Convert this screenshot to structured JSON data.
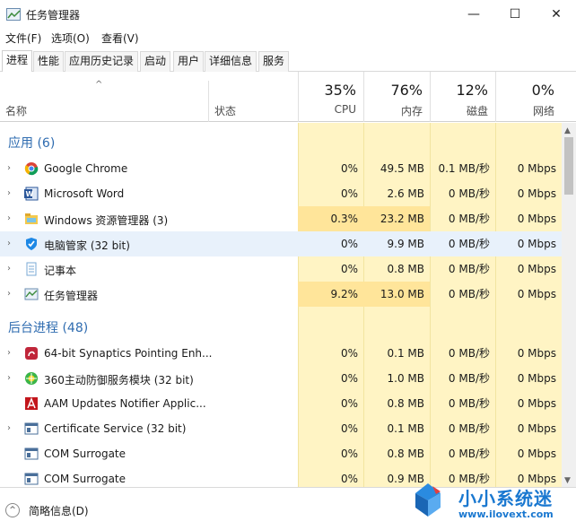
{
  "window": {
    "title": "任务管理器",
    "minimize": "—",
    "maximize": "☐",
    "close": "✕"
  },
  "menu": [
    "文件(F)",
    "选项(O)",
    "查看(V)"
  ],
  "tabs": [
    "进程",
    "性能",
    "应用历史记录",
    "启动",
    "用户",
    "详细信息",
    "服务"
  ],
  "header": {
    "sort_caret": "^",
    "name": "名称",
    "status": "状态",
    "cpu": {
      "pct": "35%",
      "label": "CPU"
    },
    "mem": {
      "pct": "76%",
      "label": "内存"
    },
    "disk": {
      "pct": "12%",
      "label": "磁盘"
    },
    "net": {
      "pct": "0%",
      "label": "网络"
    }
  },
  "groups": {
    "apps": "应用 (6)",
    "background": "后台进程 (48)"
  },
  "rows": [
    {
      "name": "Google Chrome",
      "cpu": "0%",
      "mem": "49.5 MB",
      "disk": "0.1 MB/秒",
      "net": "0 Mbps",
      "icon": "chrome-icon"
    },
    {
      "name": "Microsoft Word",
      "cpu": "0%",
      "mem": "2.6 MB",
      "disk": "0 MB/秒",
      "net": "0 Mbps",
      "icon": "word-icon"
    },
    {
      "name": "Windows 资源管理器 (3)",
      "cpu": "0.3%",
      "mem": "23.2 MB",
      "disk": "0 MB/秒",
      "net": "0 Mbps",
      "icon": "explorer-icon"
    },
    {
      "name": "电脑管家 (32 bit)",
      "cpu": "0%",
      "mem": "9.9 MB",
      "disk": "0 MB/秒",
      "net": "0 Mbps",
      "icon": "shield-icon"
    },
    {
      "name": "记事本",
      "cpu": "0%",
      "mem": "0.8 MB",
      "disk": "0 MB/秒",
      "net": "0 Mbps",
      "icon": "notepad-icon"
    },
    {
      "name": "任务管理器",
      "cpu": "9.2%",
      "mem": "13.0 MB",
      "disk": "0 MB/秒",
      "net": "0 Mbps",
      "icon": "task-manager-icon"
    },
    {
      "name": "64-bit Synaptics Pointing Enh...",
      "cpu": "0%",
      "mem": "0.1 MB",
      "disk": "0 MB/秒",
      "net": "0 Mbps",
      "icon": "synaptics-icon"
    },
    {
      "name": "360主动防御服务模块 (32 bit)",
      "cpu": "0%",
      "mem": "1.0 MB",
      "disk": "0 MB/秒",
      "net": "0 Mbps",
      "icon": "360-icon"
    },
    {
      "name": "AAM Updates Notifier Applic...",
      "cpu": "0%",
      "mem": "0.8 MB",
      "disk": "0 MB/秒",
      "net": "0 Mbps",
      "icon": "adobe-icon"
    },
    {
      "name": "Certificate Service (32 bit)",
      "cpu": "0%",
      "mem": "0.1 MB",
      "disk": "0 MB/秒",
      "net": "0 Mbps",
      "icon": "service-icon"
    },
    {
      "name": "COM Surrogate",
      "cpu": "0%",
      "mem": "0.8 MB",
      "disk": "0 MB/秒",
      "net": "0 Mbps",
      "icon": "service-icon"
    },
    {
      "name": "COM Surrogate",
      "cpu": "0%",
      "mem": "0.9 MB",
      "disk": "0 MB/秒",
      "net": "0 Mbps",
      "icon": "service-icon"
    }
  ],
  "footer": {
    "brief": "简略信息(D)",
    "collapse_glyph": "^"
  },
  "watermark": {
    "title": "小小系统迷",
    "url": "www.ilovext.com"
  },
  "colors": {
    "accent": "#2f6cb0",
    "column_bg": "#fff4c4",
    "hot": "#ffe59a",
    "highlight": "#e8f1fb",
    "watermark": "#1a78d0"
  }
}
